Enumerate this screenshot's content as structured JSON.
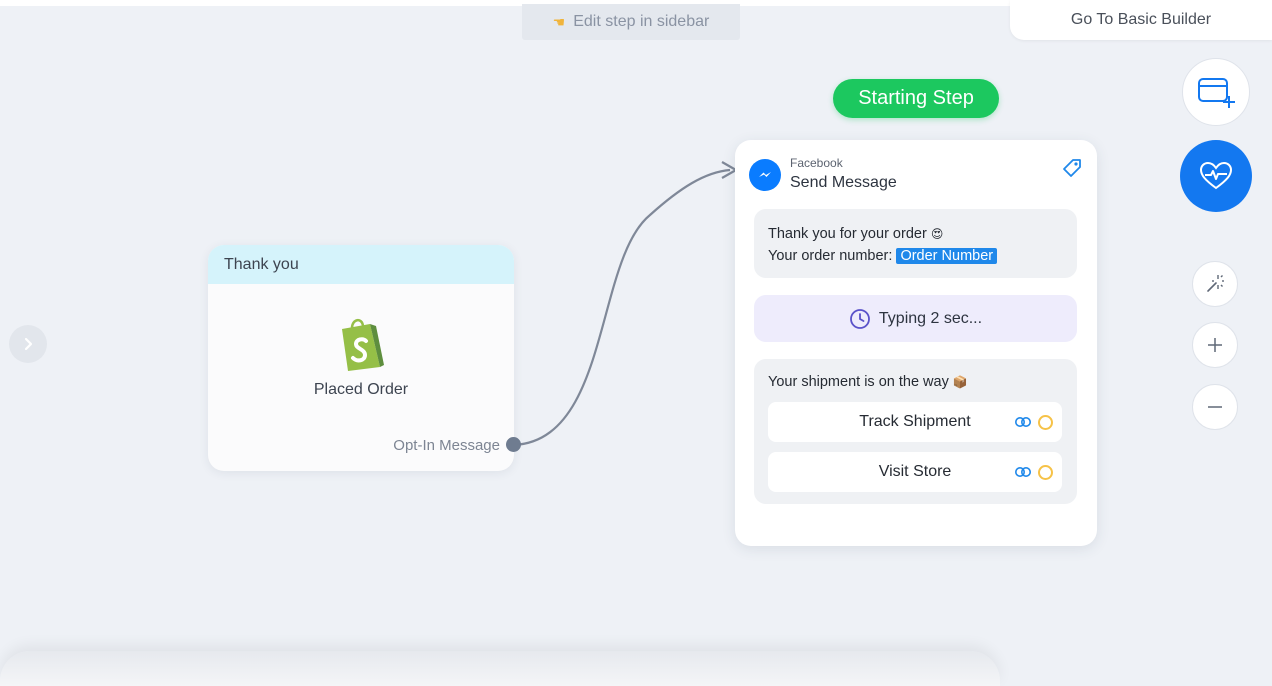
{
  "toolbar": {
    "hint_label": "Edit step in sidebar",
    "basic_builder_label": "Go To Basic Builder"
  },
  "trigger_node": {
    "header": "Thank you",
    "icon": "shopify-bag-icon",
    "label": "Placed Order",
    "output_label": "Opt-In Message"
  },
  "start_badge": "Starting Step",
  "message_node": {
    "channel": "Facebook",
    "title": "Send Message",
    "text_line1": "Thank you for your order",
    "text_line2": "Your order number:",
    "variable_chip": "Order Number",
    "typing_label": "Typing 2 sec...",
    "shipment_text": "Your shipment is on the way",
    "buttons": [
      {
        "label": "Track Shipment"
      },
      {
        "label": "Visit Store"
      }
    ]
  },
  "tools": [
    "add-card-icon",
    "heart-pulse-icon",
    "magic-wand-icon",
    "zoom-in-icon",
    "zoom-out-icon"
  ],
  "colors": {
    "accent_blue": "#1378f0",
    "start_green": "#1cc85f",
    "trigger_header": "#d5f3fb",
    "typing_bg": "#eeecfc",
    "variable_chip": "#1f88ea"
  }
}
